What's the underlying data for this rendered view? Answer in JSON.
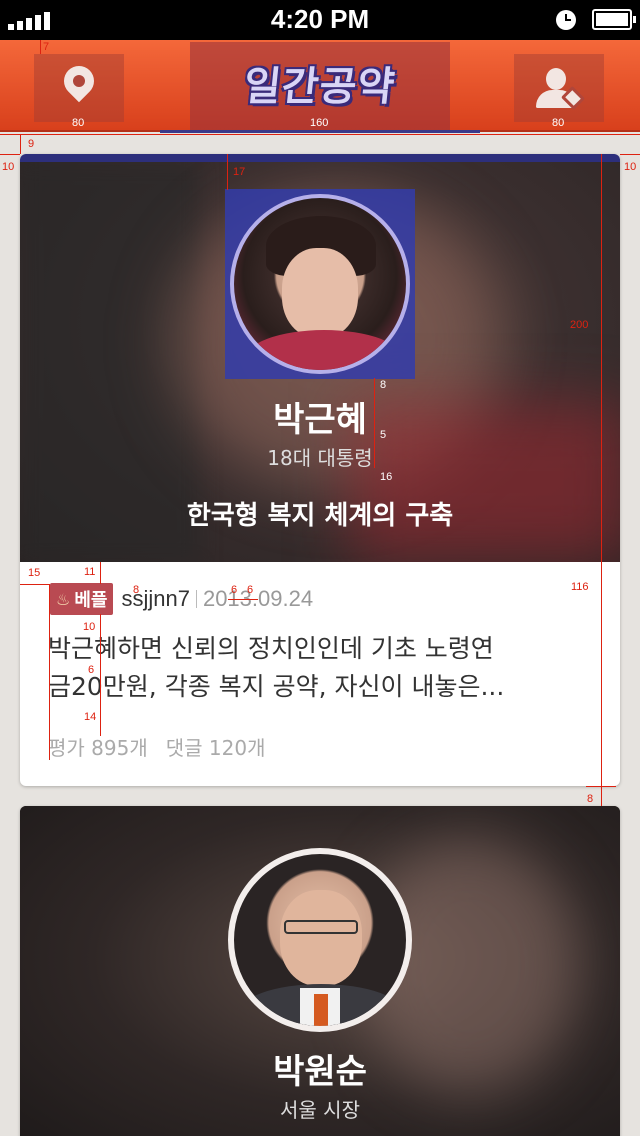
{
  "status_bar": {
    "time": "4:20 PM",
    "icons": [
      "signal-icon",
      "alarm-icon",
      "battery-icon"
    ]
  },
  "nav": {
    "title": "일간공약",
    "left_icon": "location-pin-icon",
    "right_icon": "user-profile-icon"
  },
  "cards": [
    {
      "name": "박근혜",
      "role": "18대 대통령",
      "pledge": "한국형 복지 체계의 구축",
      "post": {
        "badge": "베플",
        "badge_icon": "♨",
        "username": "ssjjnn7",
        "date": "2013.09.24",
        "body_line1": "박근혜하면 신뢰의 정치인인데 기초 노령연",
        "body_line2": "금20만원, 각종 복지 공약, 자신이 내놓은...",
        "rating": "평가 895개",
        "comments": "댓글 120개"
      }
    },
    {
      "name": "박원순",
      "role": "서울 시장"
    }
  ],
  "annotations": {
    "nav_top": "7",
    "nav_left_w": "80",
    "nav_center_w": "160",
    "nav_right_w": "80",
    "gap_top": "9",
    "side_left": "10",
    "side_right": "10",
    "avatar_top": "17",
    "hero_h": "200",
    "name_gap": "8",
    "role_gap": "5",
    "pledge_gap": "16",
    "meta_left": "15",
    "meta_top": "11",
    "badge_gap": "8",
    "sep_left": "6",
    "sep_right": "6",
    "body_top": "10",
    "line_gap": "6",
    "stats_gap": "14",
    "post_h": "116",
    "card_gap": "8"
  },
  "colors": {
    "nav_top": "#f4683a",
    "nav_bottom": "#d8401c",
    "indicator": "#3a3a8a",
    "badge": "#b94a52",
    "annotation": "#dd2211"
  }
}
